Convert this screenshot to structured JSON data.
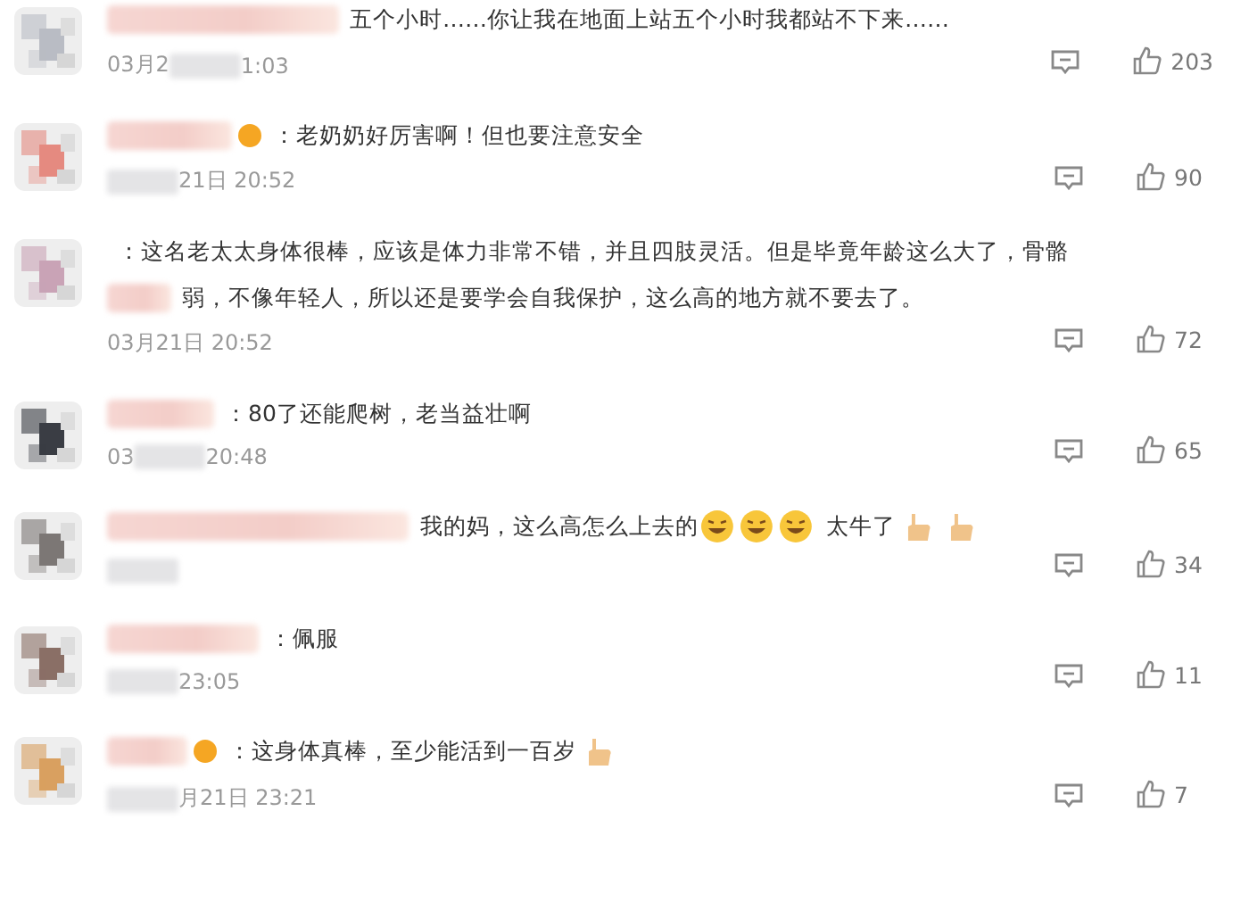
{
  "comments": [
    {
      "badge": false,
      "lines": [
        [
          {
            "kind": "text",
            "text": "五个小时……你让我在地面上站五个小时我都站不下来……"
          }
        ]
      ],
      "date": [
        {
          "kind": "text",
          "text": "03月2"
        },
        {
          "kind": "blur"
        },
        {
          "kind": "text",
          "text": "1:03"
        }
      ],
      "likes": "203"
    },
    {
      "badge": true,
      "lines": [
        [
          {
            "kind": "text",
            "text": "：老奶奶好厉害啊！但也要注意安全"
          }
        ]
      ],
      "date": [
        {
          "kind": "blur"
        },
        {
          "kind": "text",
          "text": "21日 20:52"
        }
      ],
      "likes": "90"
    },
    {
      "badge": false,
      "lines": [
        [
          {
            "kind": "text",
            "text": "：这名老太太身体很棒，应该是体力非常不错，并且四肢灵活。但是毕竟年龄这么大了，骨骼"
          }
        ],
        [
          {
            "kind": "blur"
          },
          {
            "kind": "text",
            "text": "弱，不像年轻人，所以还是要学会自我保护，这么高的地方就不要去了。"
          }
        ]
      ],
      "date": [
        {
          "kind": "text",
          "text": "03月21日 20:52"
        }
      ],
      "likes": "72"
    },
    {
      "badge": false,
      "lines": [
        [
          {
            "kind": "text",
            "text": "：80了还能爬树，老当益壮啊"
          }
        ]
      ],
      "date": [
        {
          "kind": "text",
          "text": "03"
        },
        {
          "kind": "blur"
        },
        {
          "kind": "text",
          "text": "20:48"
        }
      ],
      "likes": "65"
    },
    {
      "badge": false,
      "lines": [
        [
          {
            "kind": "text",
            "text": "我的妈，这么高怎么上去的"
          },
          {
            "kind": "laugh"
          },
          {
            "kind": "laugh"
          },
          {
            "kind": "laugh"
          },
          {
            "kind": "text",
            "text": "太牛了"
          },
          {
            "kind": "thumb"
          },
          {
            "kind": "thumb"
          }
        ]
      ],
      "date": [
        {
          "kind": "blur"
        }
      ],
      "likes": "34"
    },
    {
      "badge": false,
      "lines": [
        [
          {
            "kind": "text",
            "text": "：佩服"
          }
        ]
      ],
      "date": [
        {
          "kind": "blur"
        },
        {
          "kind": "text",
          "text": "23:05"
        }
      ],
      "likes": "11"
    },
    {
      "badge": true,
      "lines": [
        [
          {
            "kind": "text",
            "text": "：这身体真棒，至少能活到一百岁"
          },
          {
            "kind": "thumb"
          }
        ]
      ],
      "date": [
        {
          "kind": "blur"
        },
        {
          "kind": "text",
          "text": "月21日 23:21"
        }
      ],
      "likes": "7"
    }
  ]
}
